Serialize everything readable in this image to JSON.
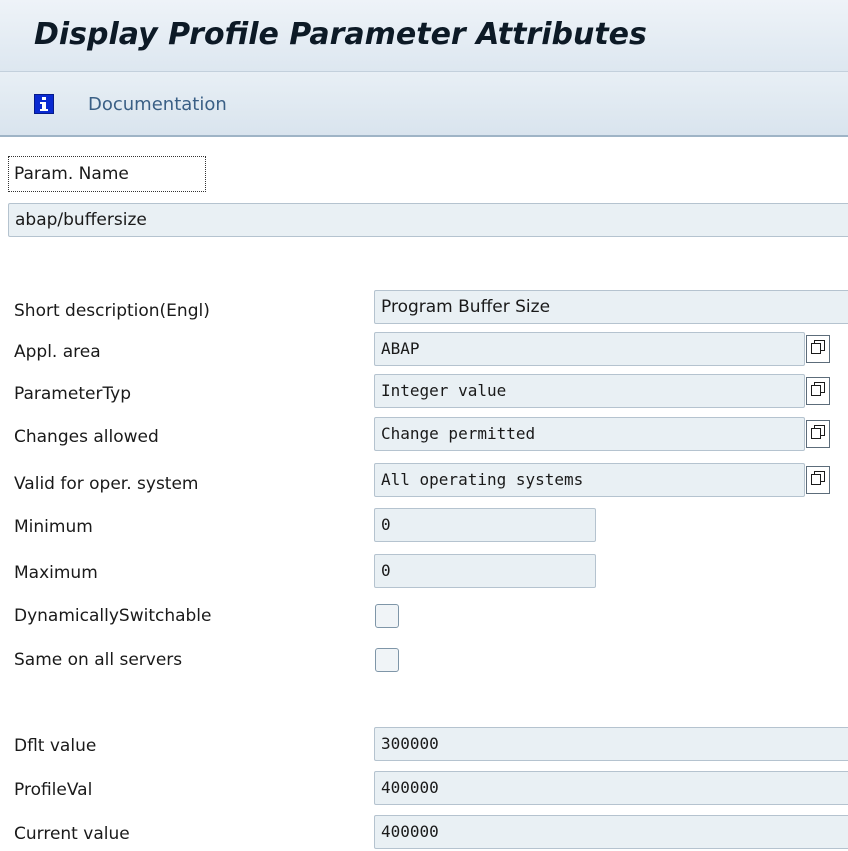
{
  "header": {
    "title": "Display Profile Parameter Attributes"
  },
  "toolbar": {
    "documentation_label": "Documentation",
    "documentation_icon": "info-icon"
  },
  "param_name": {
    "label": "Param. Name",
    "value": "abap/buffersize"
  },
  "attributes": {
    "short_description": {
      "label": "Short description(Engl)",
      "value": "Program Buffer Size"
    },
    "appl_area": {
      "label": "Appl. area",
      "value": "ABAP"
    },
    "parameter_type": {
      "label": "ParameterTyp",
      "value": "Integer value"
    },
    "changes_allowed": {
      "label": "Changes allowed",
      "value": "Change permitted"
    },
    "valid_os": {
      "label": "Valid for oper. system",
      "value": "All operating systems"
    },
    "minimum": {
      "label": "Minimum",
      "value": "0"
    },
    "maximum": {
      "label": "Maximum",
      "value": "0"
    },
    "dynamically_switchable": {
      "label": "DynamicallySwitchable",
      "checked": false
    },
    "same_on_all_servers": {
      "label": "Same on all servers",
      "checked": false
    }
  },
  "values": {
    "default": {
      "label": "Dflt value",
      "value": "300000"
    },
    "profile": {
      "label": "ProfileVal",
      "value": "400000"
    },
    "current": {
      "label": "Current value",
      "value": "400000"
    }
  },
  "colors": {
    "info_icon": "#0a2ad1",
    "field_bg": "#e9f0f4",
    "header_bg": "#e4ecf3",
    "link_text": "#3a5f85"
  }
}
